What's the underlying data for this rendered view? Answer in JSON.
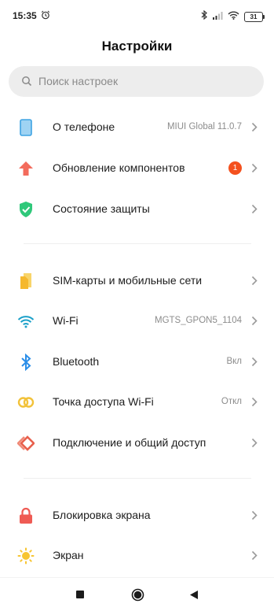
{
  "status_bar": {
    "time": "15:35",
    "battery": "31"
  },
  "title": "Настройки",
  "search": {
    "placeholder": "Поиск настроек"
  },
  "colors": {
    "accent_badge": "#f4511e",
    "wifi": "#1da1c9",
    "bluetooth": "#2b8ee8"
  },
  "group1": [
    {
      "icon": "phone-icon",
      "label": "О телефоне",
      "value": "MIUI Global 11.0.7"
    },
    {
      "icon": "update-arrow-icon",
      "label": "Обновление компонентов",
      "badge": "1"
    },
    {
      "icon": "shield-check-icon",
      "label": "Состояние защиты"
    }
  ],
  "group2": [
    {
      "icon": "sim-card-icon",
      "label": "SIM-карты и мобильные сети"
    },
    {
      "icon": "wifi-icon",
      "label": "Wi-Fi",
      "value": "MGTS_GPON5_1104"
    },
    {
      "icon": "bluetooth-icon",
      "label": "Bluetooth",
      "value": "Вкл"
    },
    {
      "icon": "hotspot-icon",
      "label": "Точка доступа Wi-Fi",
      "value": "Откл"
    },
    {
      "icon": "connection-sharing-icon",
      "label": "Подключение и общий доступ"
    }
  ],
  "group3": [
    {
      "icon": "lock-icon",
      "label": "Блокировка экрана"
    },
    {
      "icon": "sun-icon",
      "label": "Экран"
    }
  ],
  "nav": {
    "recents": "square-icon",
    "home": "circle-icon",
    "back": "triangle-back-icon"
  }
}
